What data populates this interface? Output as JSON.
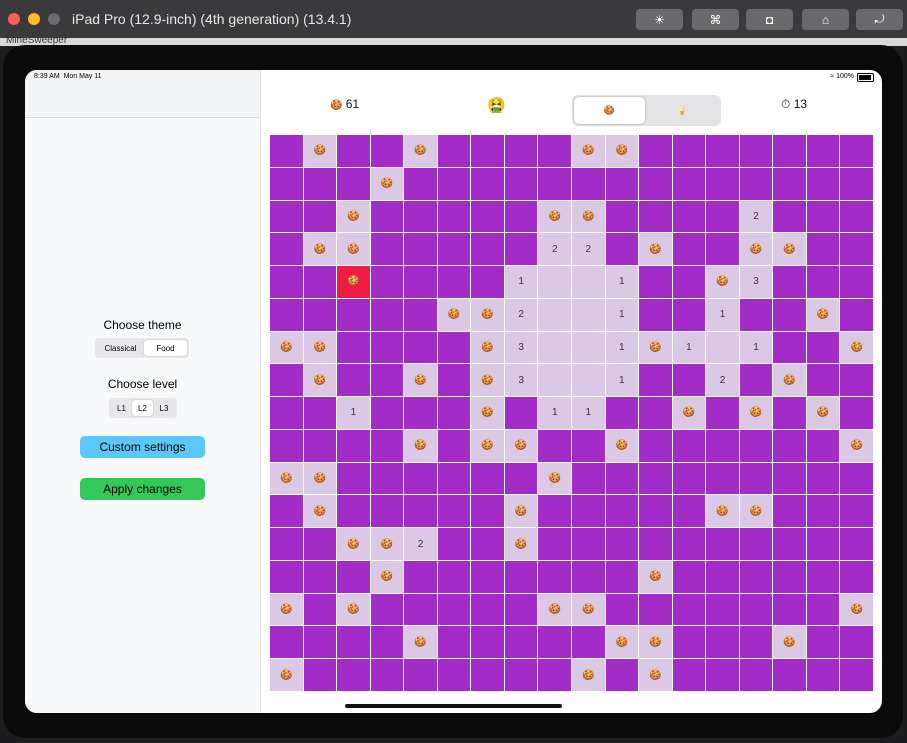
{
  "window": {
    "title": "iPad Pro (12.9-inch) (4th generation) (13.4.1)",
    "toolbar": [
      {
        "name": "brightness",
        "icon": "☀"
      },
      {
        "name": "command",
        "icon": "⌘"
      },
      {
        "name": "screenshot",
        "icon": "◘"
      },
      {
        "name": "home",
        "icon": "⌂"
      },
      {
        "name": "rotate",
        "icon": "⤾"
      }
    ],
    "background_app": "MineSweeper"
  },
  "status_bar": {
    "time": "8:39 AM",
    "date": "Mon May 11",
    "battery": "100%"
  },
  "sidebar": {
    "theme_title": "Choose theme",
    "theme_options": [
      "Classical",
      "Food"
    ],
    "theme_selected": "Food",
    "level_title": "Choose level",
    "level_options": [
      "L1",
      "L2",
      "L3"
    ],
    "level_selected": "L2",
    "custom_button": "Custom settings",
    "apply_button": "Apply changes"
  },
  "header": {
    "mine_icon": "🍪",
    "mines_left": "61",
    "face": "🤮",
    "mode_options": [
      "🍪",
      "🍦"
    ],
    "mode_selected": 0,
    "timer_icon": "⏱",
    "time": "13"
  },
  "board": {
    "rows": 17,
    "cols": 18,
    "mine_glyph": "🍪",
    "colors": {
      "hidden": "#a32bc8",
      "revealed": "#dac8e4",
      "exploded": "#ee1c45"
    },
    "cells": [
      [
        "",
        "m",
        "",
        "",
        "m",
        "",
        "",
        "",
        "",
        "m",
        "m",
        "",
        "",
        "",
        "",
        "",
        "",
        ""
      ],
      [
        "",
        "",
        "",
        "m",
        "",
        "",
        "",
        "",
        "",
        "",
        "",
        "",
        "",
        "",
        "",
        "",
        "",
        ""
      ],
      [
        "",
        "",
        "m",
        "",
        "",
        "",
        "",
        "",
        "m",
        "m",
        "",
        "",
        "",
        "",
        "2",
        "",
        "",
        ""
      ],
      [
        "",
        "m",
        "m",
        "",
        "",
        "",
        "",
        "",
        "2",
        "2",
        "",
        "m",
        "",
        "",
        "m",
        "m",
        "",
        ""
      ],
      [
        "",
        "",
        "X",
        "",
        "",
        "",
        "",
        "1",
        "e",
        "e",
        "1",
        "",
        "",
        "m",
        "3",
        "",
        "",
        ""
      ],
      [
        "",
        "",
        "",
        "",
        "",
        "m",
        "m",
        "2",
        "e",
        "e",
        "1",
        "",
        "",
        "1",
        "",
        "",
        "m",
        ""
      ],
      [
        "m",
        "m",
        "",
        "",
        "",
        "",
        "m",
        "3",
        "e",
        "e",
        "1",
        "m",
        "1",
        "e",
        "1",
        "",
        "",
        "m"
      ],
      [
        "",
        "m",
        "",
        "",
        "m",
        "",
        "m",
        "3",
        "e",
        "e",
        "1",
        "",
        "",
        "2",
        "",
        "m",
        "",
        ""
      ],
      [
        "",
        "",
        "1",
        "",
        "",
        "",
        "m",
        "",
        "1",
        "1",
        "",
        "",
        "m",
        "",
        "m",
        "",
        "m",
        ""
      ],
      [
        "",
        "",
        "",
        "",
        "m",
        "",
        "m",
        "m",
        "",
        "",
        "m",
        "",
        "",
        "",
        "",
        "",
        "",
        "m"
      ],
      [
        "m",
        "m",
        "",
        "",
        "",
        "",
        "",
        "",
        "m",
        "",
        "",
        "",
        "",
        "",
        "",
        "",
        "",
        ""
      ],
      [
        "",
        "m",
        "",
        "",
        "",
        "",
        "",
        "m",
        "",
        "",
        "",
        "",
        "",
        "m",
        "m",
        "",
        "",
        ""
      ],
      [
        "",
        "",
        "m",
        "m",
        "2",
        "",
        "",
        "m",
        "",
        "",
        "",
        "",
        "",
        "",
        "",
        "",
        "",
        ""
      ],
      [
        "",
        "",
        "",
        "m",
        "",
        "",
        "",
        "",
        "",
        "",
        "",
        "m",
        "",
        "",
        "",
        "",
        "",
        ""
      ],
      [
        "m",
        "",
        "m",
        "",
        "",
        "",
        "",
        "",
        "m",
        "m",
        "",
        "",
        "",
        "",
        "",
        "",
        "",
        "m"
      ],
      [
        "",
        "",
        "",
        "",
        "m",
        "",
        "",
        "",
        "",
        "",
        "m",
        "m",
        "",
        "",
        "",
        "m",
        "",
        ""
      ],
      [
        "m",
        "",
        "",
        "",
        "",
        "",
        "",
        "",
        "",
        "m",
        "",
        "m",
        "",
        "",
        "",
        "",
        "",
        ""
      ]
    ]
  }
}
